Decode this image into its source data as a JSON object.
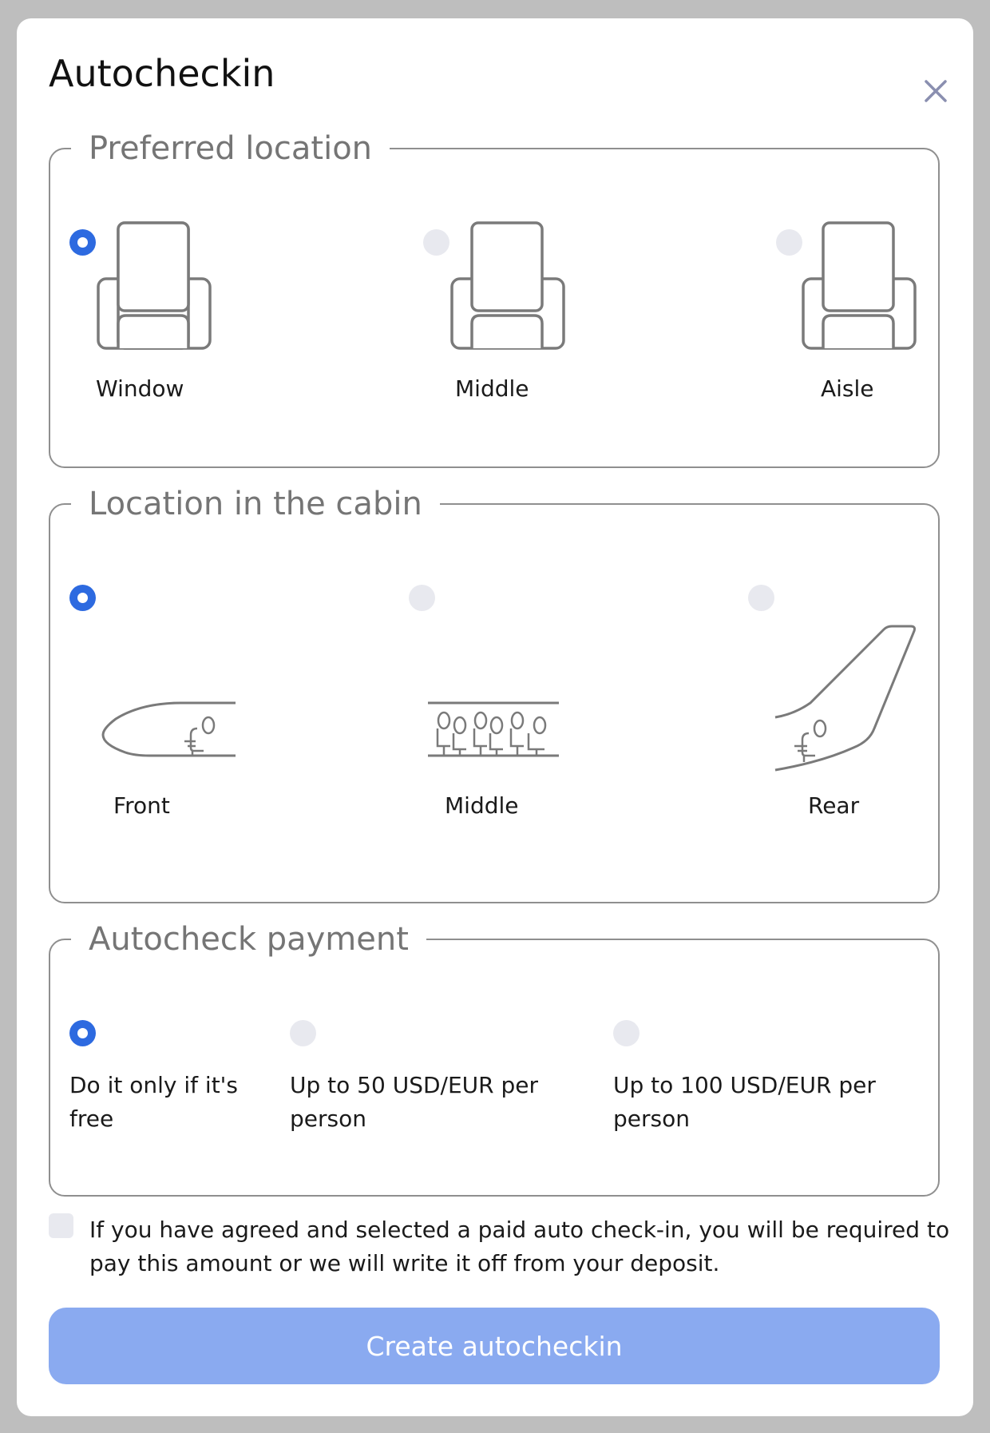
{
  "dialog": {
    "title": "Autocheckin",
    "close_icon": "close-icon"
  },
  "preferred_location": {
    "legend": "Preferred location",
    "selected": "Window",
    "options": [
      {
        "label": "Window",
        "icon": "seat-icon",
        "checked": true
      },
      {
        "label": "Middle",
        "icon": "seat-icon",
        "checked": false
      },
      {
        "label": "Aisle",
        "icon": "seat-icon",
        "checked": false
      }
    ]
  },
  "cabin_location": {
    "legend": "Location in the cabin",
    "selected": "Front",
    "options": [
      {
        "label": "Front",
        "icon": "plane-front-icon",
        "checked": true
      },
      {
        "label": "Middle",
        "icon": "plane-middle-icon",
        "checked": false
      },
      {
        "label": "Rear",
        "icon": "plane-rear-icon",
        "checked": false
      }
    ]
  },
  "payment": {
    "legend": "Autocheck payment",
    "selected": "Do it only if it's free",
    "options": [
      {
        "label": "Do it only if it's free",
        "checked": true
      },
      {
        "label": "Up to 50 USD/EUR per person",
        "checked": false
      },
      {
        "label": "Up to 100 USD/EUR per person",
        "checked": false
      }
    ]
  },
  "agreement": {
    "checked": false,
    "text": "If you have agreed and selected a paid auto check-in, you will be required to pay this amount or we will write it off from your deposit."
  },
  "submit": {
    "label": "Create autocheckin",
    "enabled": false
  },
  "colors": {
    "accent": "#2d6ae0",
    "button_disabled": "#8aaaf0",
    "radio_unchecked": "#e8e9ef",
    "overlay": "#7d7d7d"
  }
}
